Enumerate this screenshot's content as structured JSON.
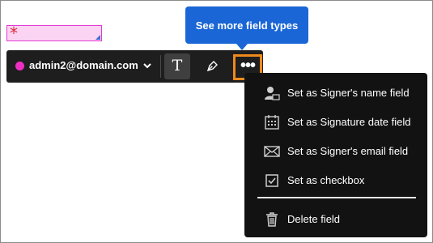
{
  "field": {
    "required_marker": "*"
  },
  "toolbar": {
    "email": "admin2@domain.com",
    "signer_color": "#ee2fc4",
    "text_tool_label": "T",
    "more_label": "•••"
  },
  "tooltip": {
    "text": "See more field types"
  },
  "menu": {
    "items": [
      {
        "label": "Set as Signer's name field",
        "icon": "person-icon"
      },
      {
        "label": "Set as Signature date field",
        "icon": "calendar-icon"
      },
      {
        "label": "Set as Signer's email field",
        "icon": "envelope-icon"
      },
      {
        "label": "Set as checkbox",
        "icon": "checkbox-icon"
      },
      {
        "label": "Delete field",
        "icon": "trash-icon"
      }
    ]
  },
  "colors": {
    "accent": "#1a66d6",
    "highlight": "#ee8a1c",
    "field_border": "#e23ad2"
  }
}
